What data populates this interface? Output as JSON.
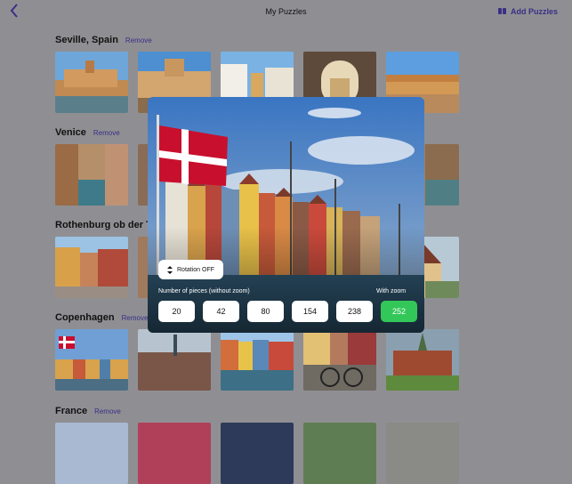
{
  "header": {
    "back_icon": "chevron-left-icon",
    "title": "My Puzzles",
    "add_label": "Add Puzzles",
    "add_icon": "puzzle-pieces-icon"
  },
  "sections": [
    {
      "name": "Seville, Spain",
      "remove": "Remove"
    },
    {
      "name": "Venice",
      "remove": "Remove"
    },
    {
      "name": "Rothenburg ob der Ta",
      "remove": ""
    },
    {
      "name": "Copenhagen",
      "remove": "Remove"
    },
    {
      "name": "France",
      "remove": "Remove"
    }
  ],
  "modal": {
    "rotation_label": "Rotation OFF",
    "rotation_icon": "rotate-icon",
    "pieces_label": "Number of pieces (without zoom)",
    "zoom_label": "With zoom",
    "pieces": [
      "20",
      "42",
      "80",
      "154",
      "238"
    ],
    "zoom_pieces": [
      "252"
    ],
    "accent": "#33c759"
  },
  "colors": {
    "background": "#8f8f93",
    "link": "#3a2f86"
  }
}
